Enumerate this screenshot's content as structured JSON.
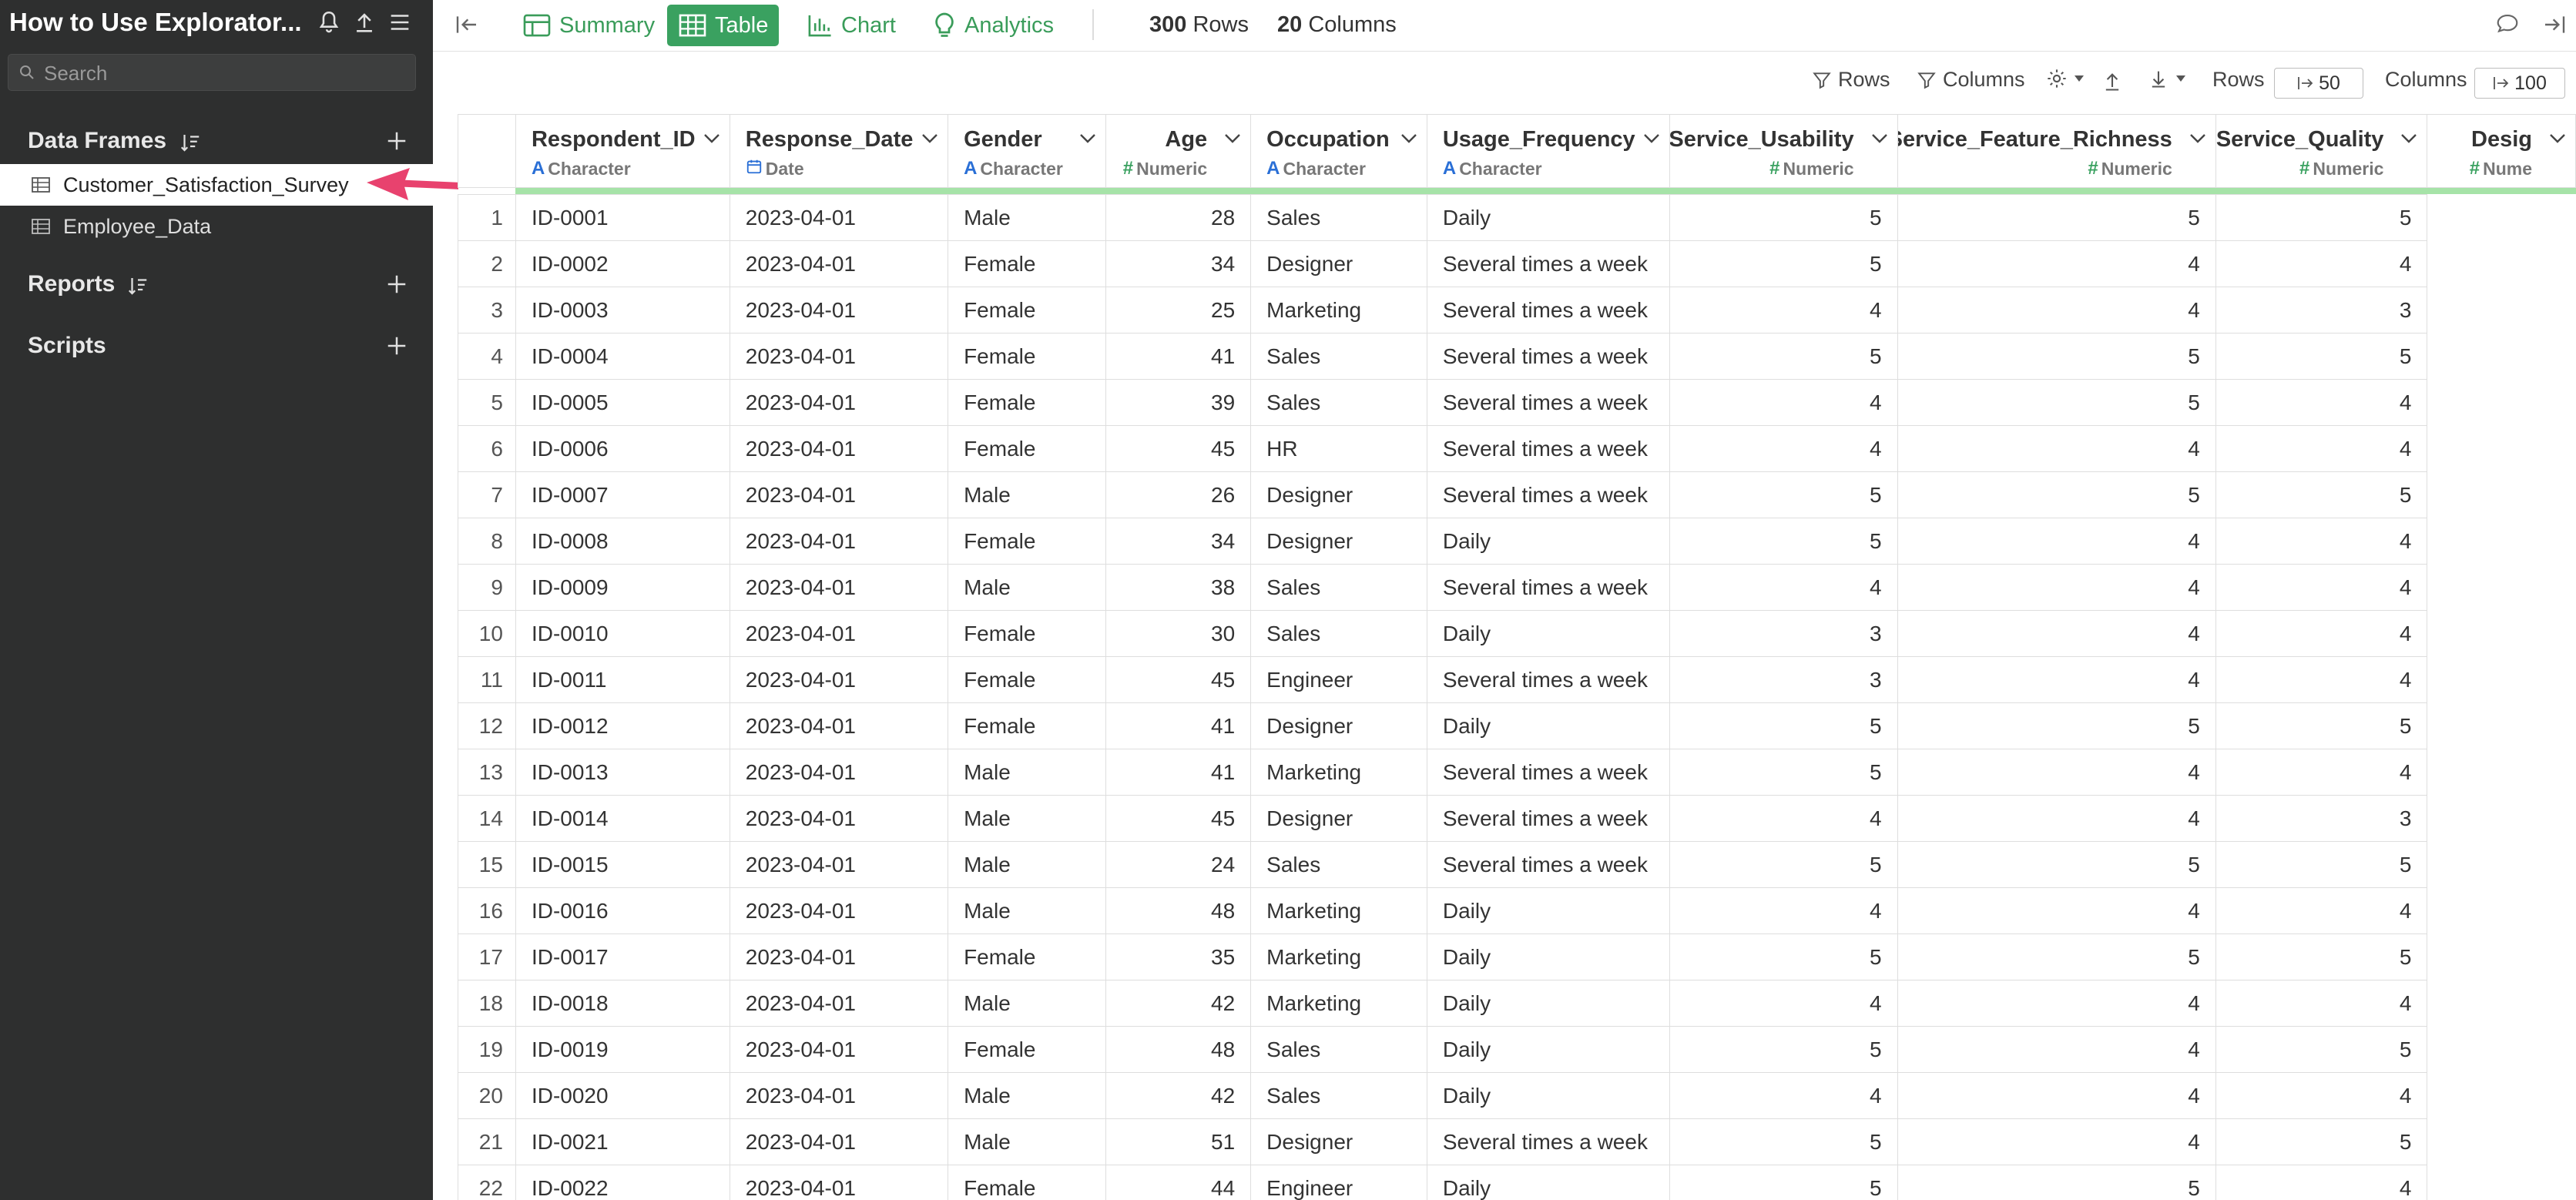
{
  "app": {
    "title": "How to Use Explorator..."
  },
  "sidebar": {
    "search_placeholder": "Search",
    "sections": {
      "data_frames": "Data Frames",
      "reports": "Reports",
      "scripts": "Scripts"
    },
    "data_frames": [
      {
        "label": "Customer_Satisfaction_Survey",
        "active": true
      },
      {
        "label": "Employee_Data",
        "active": false
      }
    ]
  },
  "toolbar": {
    "summary": "Summary",
    "table": "Table",
    "chart": "Chart",
    "analytics": "Analytics",
    "rows_count": "300",
    "rows_label": "Rows",
    "cols_count": "20",
    "cols_label": "Columns"
  },
  "subbar": {
    "rows_filter": "Rows",
    "columns_filter": "Columns",
    "rows_label": "Rows",
    "rows_value": "50",
    "columns_label": "Columns",
    "columns_value": "100"
  },
  "columns": [
    {
      "name": "Respondent_ID",
      "type": "Character",
      "kind": "char",
      "align": "left"
    },
    {
      "name": "Response_Date",
      "type": "Date",
      "kind": "date",
      "align": "left"
    },
    {
      "name": "Gender",
      "type": "Character",
      "kind": "char",
      "align": "left"
    },
    {
      "name": "Age",
      "type": "Numeric",
      "kind": "num",
      "align": "right"
    },
    {
      "name": "Occupation",
      "type": "Character",
      "kind": "char",
      "align": "left"
    },
    {
      "name": "Usage_Frequency",
      "type": "Character",
      "kind": "char",
      "align": "left"
    },
    {
      "name": "Service_Usability",
      "type": "Numeric",
      "kind": "num",
      "align": "right"
    },
    {
      "name": "Service_Feature_Richness",
      "type": "Numeric",
      "kind": "num",
      "align": "right"
    },
    {
      "name": "Service_Quality",
      "type": "Numeric",
      "kind": "num",
      "align": "right"
    },
    {
      "name": "Desig",
      "type": "Nume",
      "kind": "num",
      "align": "right"
    }
  ],
  "rows": [
    [
      "1",
      "ID-0001",
      "2023-04-01",
      "Male",
      "28",
      "Sales",
      "Daily",
      "5",
      "5",
      "5"
    ],
    [
      "2",
      "ID-0002",
      "2023-04-01",
      "Female",
      "34",
      "Designer",
      "Several times a week",
      "5",
      "4",
      "4"
    ],
    [
      "3",
      "ID-0003",
      "2023-04-01",
      "Female",
      "25",
      "Marketing",
      "Several times a week",
      "4",
      "4",
      "3"
    ],
    [
      "4",
      "ID-0004",
      "2023-04-01",
      "Female",
      "41",
      "Sales",
      "Several times a week",
      "5",
      "5",
      "5"
    ],
    [
      "5",
      "ID-0005",
      "2023-04-01",
      "Female",
      "39",
      "Sales",
      "Several times a week",
      "4",
      "5",
      "4"
    ],
    [
      "6",
      "ID-0006",
      "2023-04-01",
      "Female",
      "45",
      "HR",
      "Several times a week",
      "4",
      "4",
      "4"
    ],
    [
      "7",
      "ID-0007",
      "2023-04-01",
      "Male",
      "26",
      "Designer",
      "Several times a week",
      "5",
      "5",
      "5"
    ],
    [
      "8",
      "ID-0008",
      "2023-04-01",
      "Female",
      "34",
      "Designer",
      "Daily",
      "5",
      "4",
      "4"
    ],
    [
      "9",
      "ID-0009",
      "2023-04-01",
      "Male",
      "38",
      "Sales",
      "Several times a week",
      "4",
      "4",
      "4"
    ],
    [
      "10",
      "ID-0010",
      "2023-04-01",
      "Female",
      "30",
      "Sales",
      "Daily",
      "3",
      "4",
      "4"
    ],
    [
      "11",
      "ID-0011",
      "2023-04-01",
      "Female",
      "45",
      "Engineer",
      "Several times a week",
      "3",
      "4",
      "4"
    ],
    [
      "12",
      "ID-0012",
      "2023-04-01",
      "Female",
      "41",
      "Designer",
      "Daily",
      "5",
      "5",
      "5"
    ],
    [
      "13",
      "ID-0013",
      "2023-04-01",
      "Male",
      "41",
      "Marketing",
      "Several times a week",
      "5",
      "4",
      "4"
    ],
    [
      "14",
      "ID-0014",
      "2023-04-01",
      "Male",
      "45",
      "Designer",
      "Several times a week",
      "4",
      "4",
      "3"
    ],
    [
      "15",
      "ID-0015",
      "2023-04-01",
      "Male",
      "24",
      "Sales",
      "Several times a week",
      "5",
      "5",
      "5"
    ],
    [
      "16",
      "ID-0016",
      "2023-04-01",
      "Male",
      "48",
      "Marketing",
      "Daily",
      "4",
      "4",
      "4"
    ],
    [
      "17",
      "ID-0017",
      "2023-04-01",
      "Female",
      "35",
      "Marketing",
      "Daily",
      "5",
      "5",
      "5"
    ],
    [
      "18",
      "ID-0018",
      "2023-04-01",
      "Male",
      "42",
      "Marketing",
      "Daily",
      "4",
      "4",
      "4"
    ],
    [
      "19",
      "ID-0019",
      "2023-04-01",
      "Female",
      "48",
      "Sales",
      "Daily",
      "5",
      "4",
      "5"
    ],
    [
      "20",
      "ID-0020",
      "2023-04-01",
      "Male",
      "42",
      "Sales",
      "Daily",
      "4",
      "4",
      "4"
    ],
    [
      "21",
      "ID-0021",
      "2023-04-01",
      "Male",
      "51",
      "Designer",
      "Several times a week",
      "5",
      "4",
      "5"
    ],
    [
      "22",
      "ID-0022",
      "2023-04-01",
      "Female",
      "44",
      "Engineer",
      "Daily",
      "5",
      "5",
      "4"
    ]
  ],
  "colors": {
    "accent": "#3aa160",
    "sidebar_bg": "#2e2f2f",
    "arrow": "#e8426e",
    "character_type": "#2a6fd6"
  }
}
